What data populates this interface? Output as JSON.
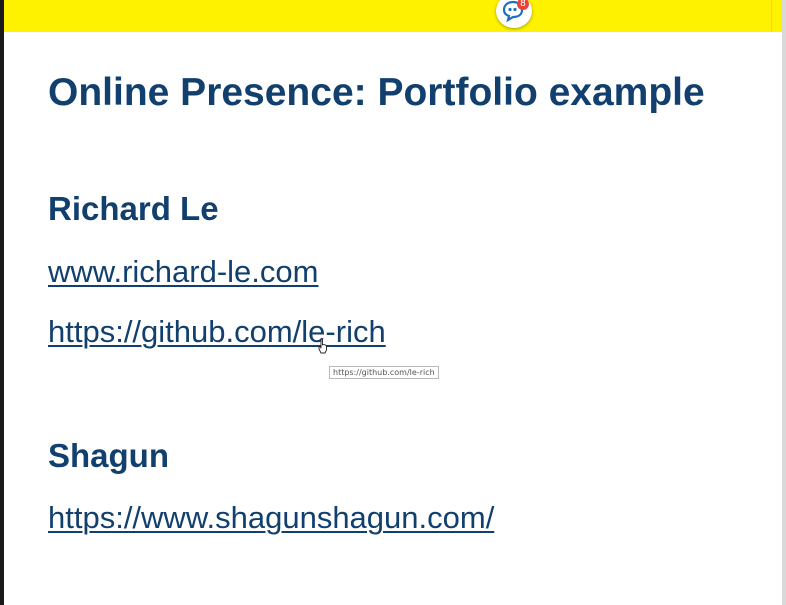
{
  "topbar": {
    "app_icon": "chat-bubble-icon",
    "notification_count": "8",
    "colors": {
      "bar": "#fff200",
      "badge": "#e8433a",
      "icon": "#1f6fc5"
    }
  },
  "slide": {
    "title": "Online Presence: Portfolio example",
    "text_color": "#12406e",
    "people": [
      {
        "name": "Richard Le",
        "links": [
          "www.richard-le.com",
          "https://github.com/le-rich"
        ]
      },
      {
        "name": "Shagun",
        "links": [
          "https://www.shagunshagun.com/"
        ]
      }
    ]
  },
  "tooltip": {
    "text": "https://github.com/le-rich",
    "cursor_icon": "hand-pointer-icon"
  }
}
